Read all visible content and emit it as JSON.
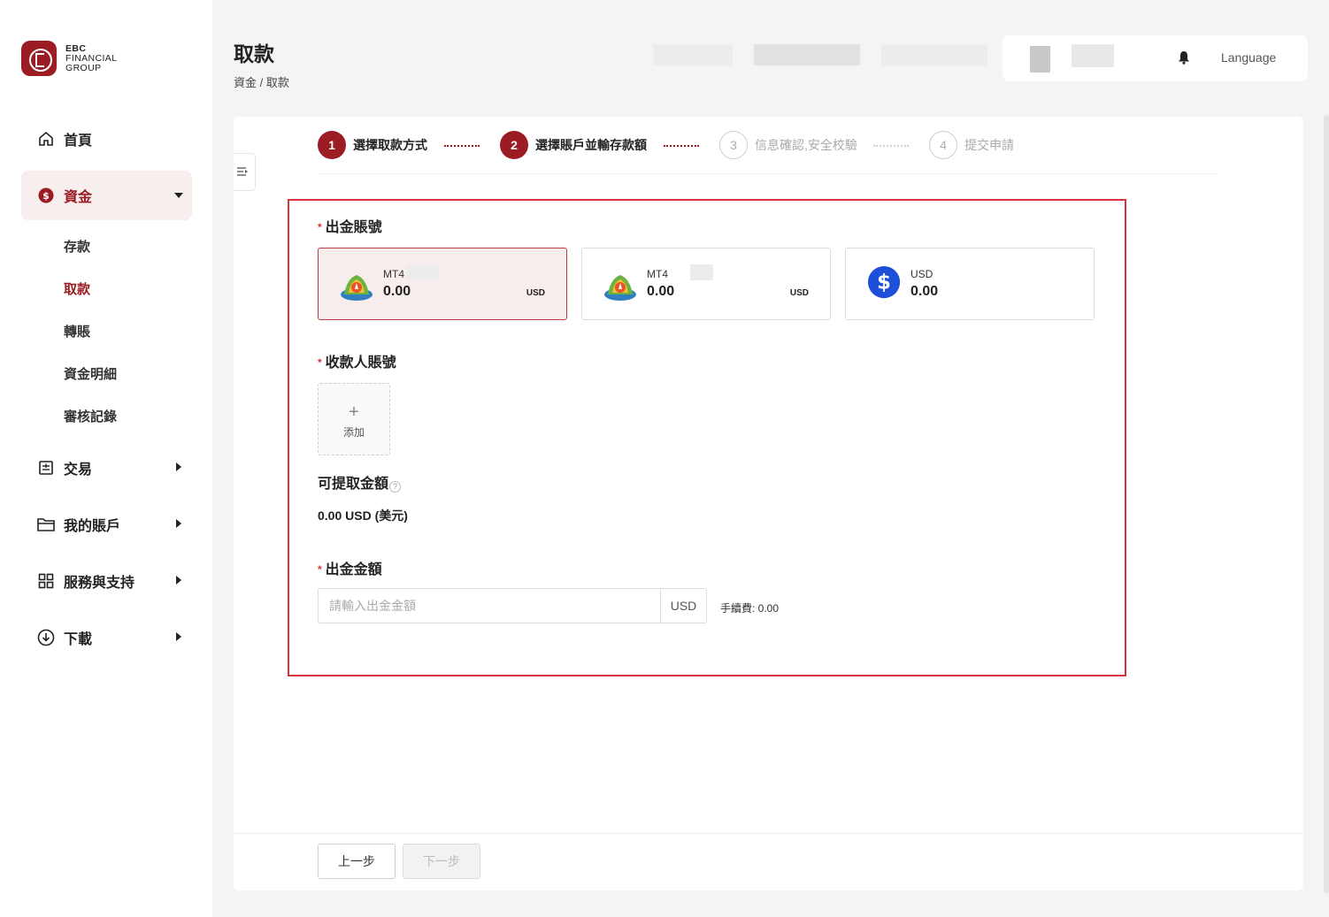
{
  "brand": {
    "line1": "EBC",
    "line2": "FINANCIAL",
    "line3": "GROUP"
  },
  "sidebar": {
    "items": [
      {
        "label": "首頁",
        "icon": "home-icon"
      },
      {
        "label": "資金",
        "icon": "dollar-circle-icon"
      },
      {
        "label": "交易",
        "icon": "trade-icon"
      },
      {
        "label": "我的賬戶",
        "icon": "folder-icon"
      },
      {
        "label": "服務與支持",
        "icon": "grid-icon"
      },
      {
        "label": "下載",
        "icon": "download-icon"
      }
    ],
    "sub_items": [
      "存款",
      "取款",
      "轉賬",
      "資金明細",
      "審核記錄"
    ]
  },
  "header": {
    "title": "取款",
    "breadcrumb": "資金 / 取款",
    "language": "Language"
  },
  "steps": [
    {
      "num": "1",
      "label": "選擇取款方式"
    },
    {
      "num": "2",
      "label": "選擇賬戶並輸存款額"
    },
    {
      "num": "3",
      "label": "信息確認,安全校驗"
    },
    {
      "num": "4",
      "label": "提交申請"
    }
  ],
  "form": {
    "required_mark": "*",
    "source_label": "出金賬號",
    "accounts": [
      {
        "platform": "MT4",
        "balance": "0.00",
        "currency": "USD",
        "icon": "mt4-icon"
      },
      {
        "platform": "MT4",
        "balance": "0.00",
        "currency": "USD",
        "icon": "mt4-icon"
      },
      {
        "platform": "USD",
        "balance": "0.00",
        "currency": "",
        "icon": "dollar-icon"
      }
    ],
    "payee_label": "收款人賬號",
    "add_plus": "+",
    "add_label": "添加",
    "available_label": "可提取金額",
    "help_glyph": "?",
    "available_value": "0.00 USD (美元)",
    "amount_label": "出金金額",
    "amount_placeholder": "請輸入出金金額",
    "amount_value": "",
    "amount_suffix": "USD",
    "fee_text": "手續費: 0.00"
  },
  "footer": {
    "prev": "上一步",
    "next": "下一步"
  },
  "colors": {
    "accent": "#9b1c22",
    "frame": "#d7333c",
    "selected_bg": "#f8eded"
  }
}
